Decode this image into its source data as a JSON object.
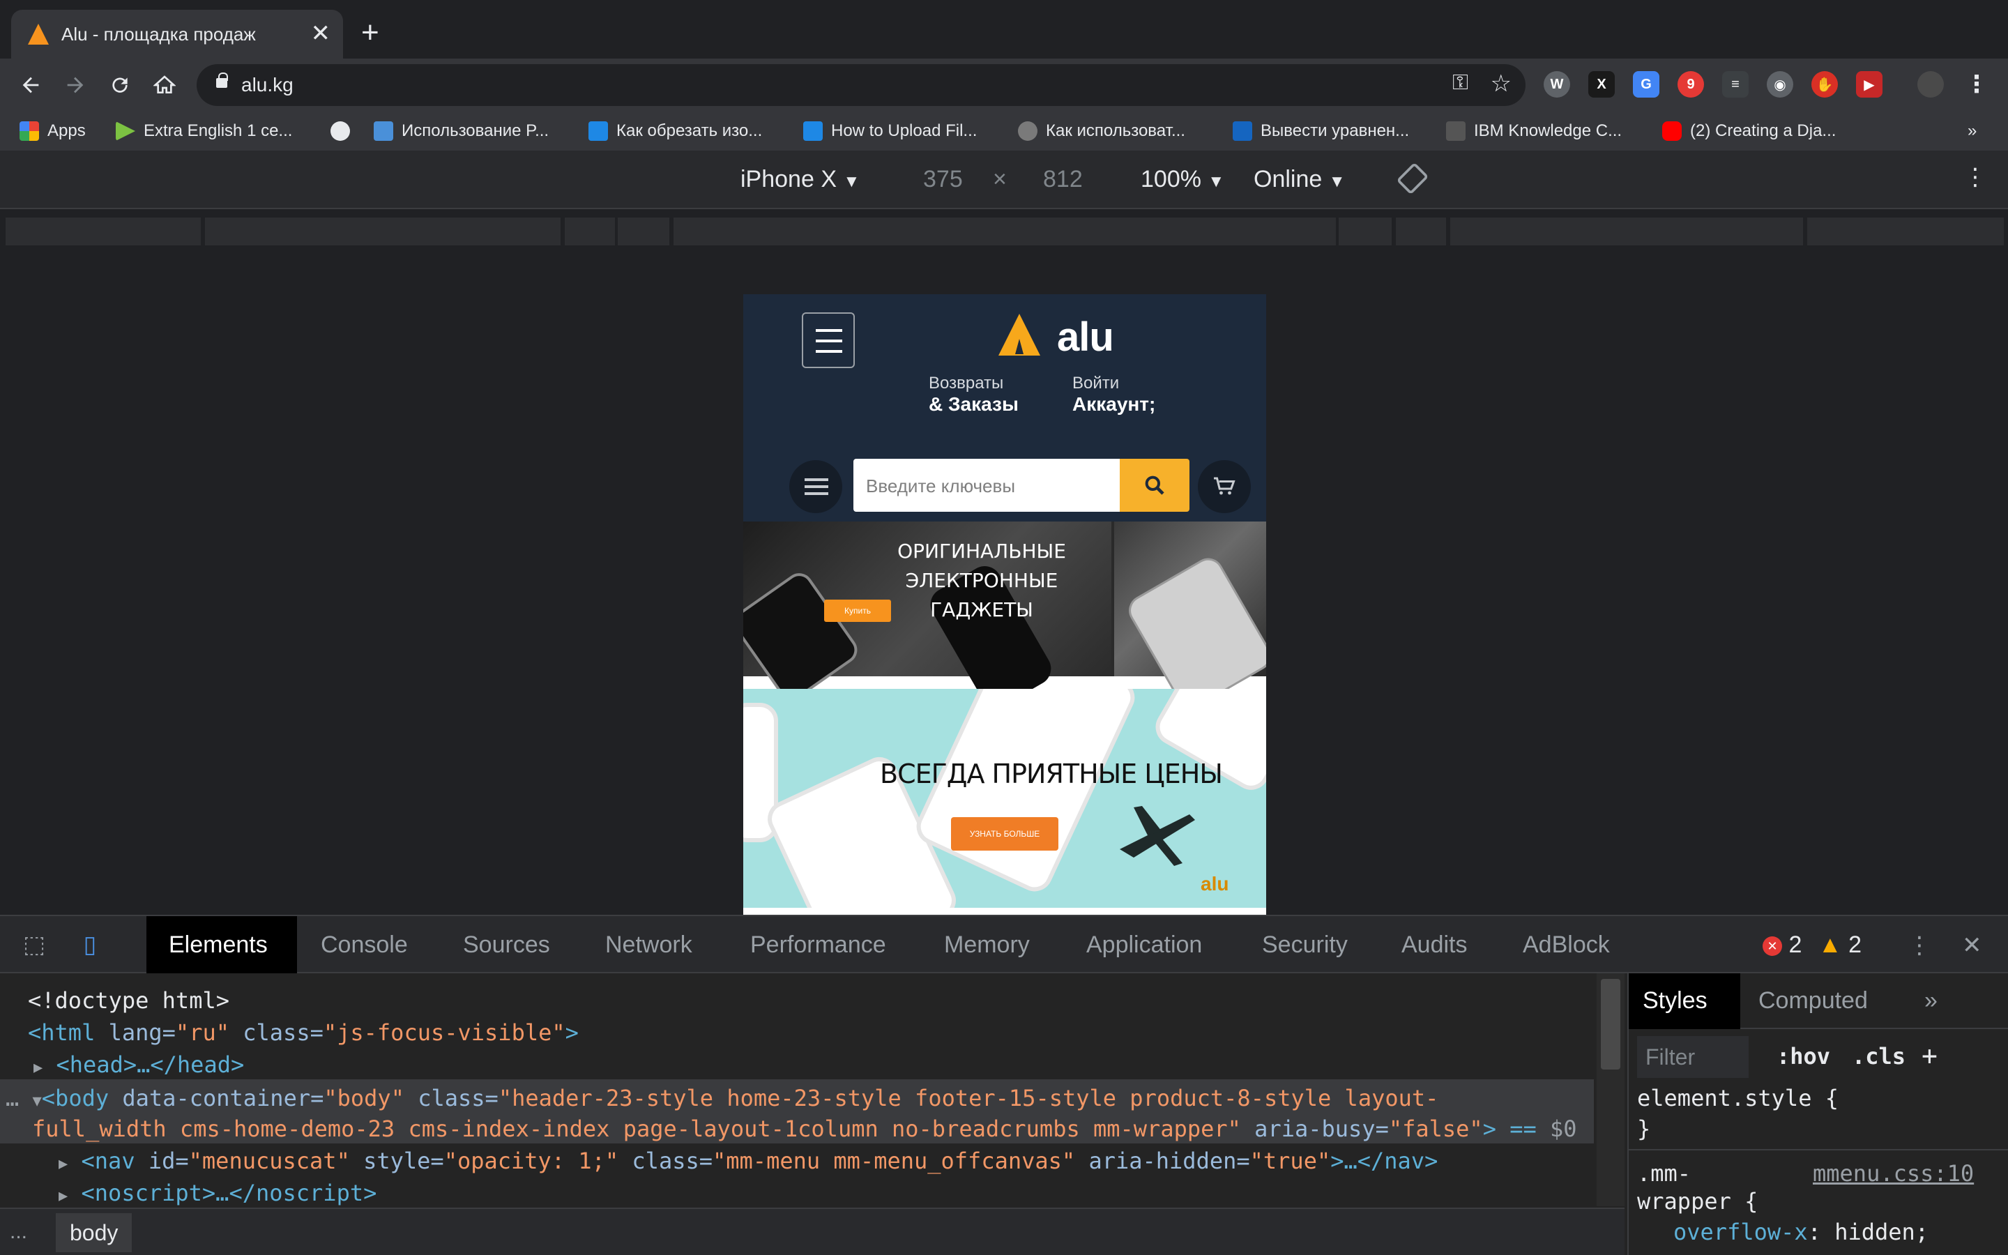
{
  "browser": {
    "tab_title": "Alu - площадка продаж",
    "tab_close": "✕",
    "new_tab": "+",
    "url": "alu.kg"
  },
  "bookmarks": [
    {
      "label": "Apps",
      "color": "#e74c3c"
    },
    {
      "label": "Extra English 1 ce...",
      "color": "#7cc242"
    },
    {
      "label": "",
      "color": "#e8eaed"
    },
    {
      "label": "Использование P...",
      "color": "#4a90d9"
    },
    {
      "label": "Как обрезать изо...",
      "color": "#1e88e5"
    },
    {
      "label": "How to Upload Fil...",
      "color": "#1e88e5"
    },
    {
      "label": "Как использоват...",
      "color": "#7a7a7a"
    },
    {
      "label": "Вывести уравнен...",
      "color": "#1565c0"
    },
    {
      "label": "IBM Knowledge C...",
      "color": "#555555"
    },
    {
      "label": "(2) Creating a Dja...",
      "color": "#ff0000"
    }
  ],
  "bookmarks_more": "»",
  "device_toolbar": {
    "device": "iPhone X",
    "width": "375",
    "times": "×",
    "height": "812",
    "zoom": "100%",
    "network": "Online"
  },
  "site": {
    "logo_text": "alu",
    "returns_small": "Возвраты",
    "returns_big": "& Заказы",
    "login_small": "Войти",
    "login_big": "Аккаунт;",
    "search_placeholder": "Введите ключевы",
    "banner1_line1": "ОРИГИНАЛЬНЫЕ",
    "banner1_line2": "ЭЛЕКТРОННЫЕ ГАДЖЕТЫ",
    "banner1_button": "Купить",
    "banner2_text": "ВСЕГДА ПРИЯТНЫЕ ЦЕНЫ",
    "banner2_button": "УЗНАТЬ БОЛЬШЕ",
    "banner2_logo": "alu"
  },
  "devtools": {
    "tabs": [
      "Elements",
      "Console",
      "Sources",
      "Network",
      "Performance",
      "Memory",
      "Application",
      "Security",
      "Audits",
      "AdBlock"
    ],
    "active_tab": "Elements",
    "errors": "2",
    "warnings": "2",
    "breadcrumb": "body",
    "breadcrumb_more": "...",
    "styles_tabs": [
      "Styles",
      "Computed"
    ],
    "styles_more": "»",
    "filter_placeholder": "Filter",
    "hov": ":hov",
    "cls": ".cls",
    "plus": "+",
    "element_style": "element.style {",
    "close_brace": "}",
    "rule_selector_1": ".mm-",
    "rule_selector_2": "wrapper {",
    "rule_source": "mmenu.css:10",
    "rule_prop": "overflow-x",
    "rule_val": "hidden;"
  },
  "dom": {
    "doctype": "<!doctype html>",
    "html_open": "<html",
    "html_lang_attr": " lang=",
    "html_lang_val": "\"ru\"",
    "html_class_attr": " class=",
    "html_class_val": "\"js-focus-visible\"",
    "gt": ">",
    "head": "<head>…</head>",
    "body_dots": "…",
    "body_open": "<body",
    "body_attr1": " data-container=",
    "body_val1": "\"body\"",
    "body_attr2": " class=",
    "body_val2a": "\"header-23-style home-23-style footer-15-style product-8-style layout-",
    "body_val2b": "full_width cms-home-demo-23 cms-index-index page-layout-1column no-breadcrumbs mm-wrapper\"",
    "body_attr3": " aria-busy=",
    "body_val3": "\"false\"",
    "body_end": "> == ",
    "nav_open": "<nav",
    "nav_id_attr": " id=",
    "nav_id_val": "\"menucuscat\"",
    "nav_style_attr": " style=",
    "nav_style_val": "\"opacity: 1;\"",
    "nav_class_attr": " class=",
    "nav_class_val": "\"mm-menu mm-menu_offcanvas\"",
    "nav_aria_attr": " aria-hidden=",
    "nav_aria_val": "\"true\"",
    "nav_end": ">…</nav>",
    "noscript": "<noscript>…</noscript>"
  }
}
